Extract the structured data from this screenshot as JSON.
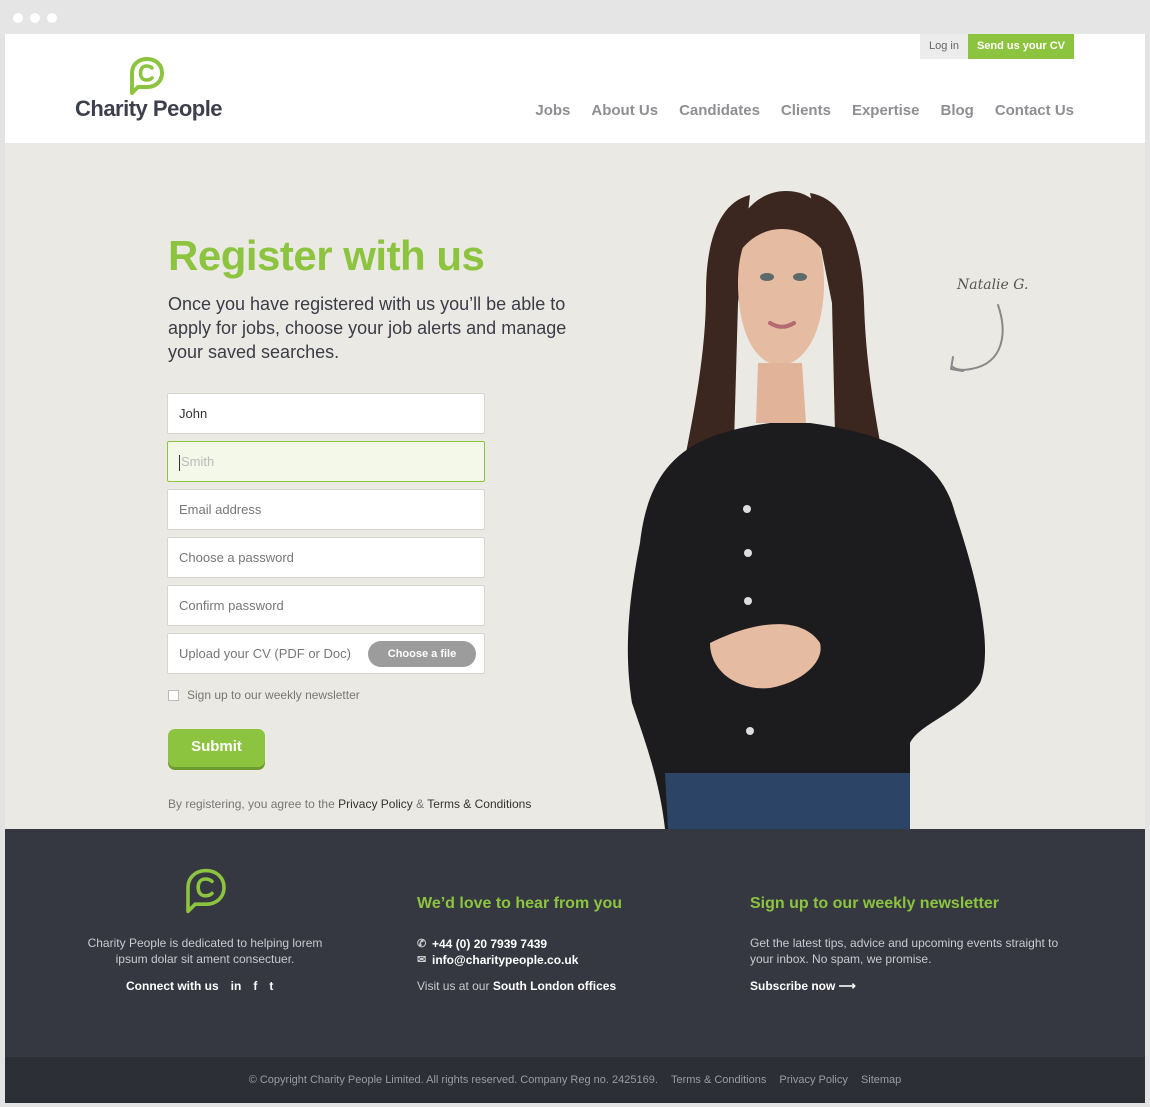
{
  "header": {
    "logo_text": "Charity People",
    "login_label": "Log in",
    "send_cv_label": "Send us your CV",
    "nav": [
      "Jobs",
      "About Us",
      "Candidates",
      "Clients",
      "Expertise",
      "Blog",
      "Contact Us"
    ]
  },
  "hero": {
    "title": "Register with us",
    "subtitle": "Once you have registered with us you’ll be able to apply for jobs, choose your job alerts and manage your saved searches.",
    "fields": {
      "first_name": "John",
      "last_name_placeholder": "Smith",
      "email_placeholder": "Email address",
      "password_placeholder": "Choose a password",
      "confirm_placeholder": "Confirm password",
      "cv_placeholder": "Upload your CV (PDF or Doc)",
      "choose_file_label": "Choose a file"
    },
    "newsletter_label": "Sign up to our weekly newsletter",
    "submit_label": "Submit",
    "terms_prefix": "By registering, you agree to the",
    "privacy_label": "Privacy Policy",
    "amp": "&",
    "terms_label": "Terms & Conditions",
    "signature": "Natalie G."
  },
  "footer": {
    "about_text": "Charity People is dedicated to helping lorem ipsum dolar sit ament consectuer.",
    "connect_label": "Connect with us",
    "social": [
      "in",
      "f",
      "t"
    ],
    "contact_heading": "We’d love to hear from you",
    "phone": "+44 (0) 20 7939 7439",
    "email": "info@charitypeople.co.uk",
    "visit_prefix": "Visit us at our",
    "visit_link": "South London offices",
    "newsletter_heading": "Sign up to our weekly newsletter",
    "newsletter_text": "Get the latest tips, advice and upcoming events straight to your inbox. No spam, we promise.",
    "subscribe_label": "Subscribe now ⟶"
  },
  "bottom": {
    "copyright": "© Copyright Charity People Limited. All rights reserved. Company Reg no. 2425169.",
    "terms": "Terms & Conditions",
    "privacy": "Privacy Policy",
    "sitemap": "Sitemap"
  },
  "colors": {
    "accent": "#8dc43f",
    "footer_bg": "#353841",
    "hero_bg": "#ebe9e3"
  }
}
